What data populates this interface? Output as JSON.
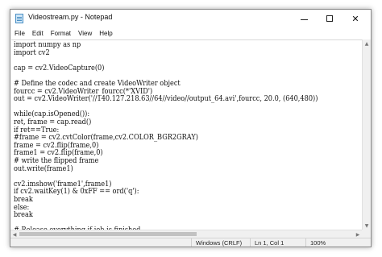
{
  "window": {
    "title": "Videostream.py - Notepad",
    "app_icon": "notepad-icon",
    "controls": {
      "minimize_icon": "minimize-icon",
      "maximize_icon": "maximize-icon",
      "close_glyph": "✕"
    }
  },
  "menu": {
    "items": [
      "File",
      "Edit",
      "Format",
      "View",
      "Help"
    ]
  },
  "editor": {
    "lines": [
      "import numpy as np",
      "import cv2",
      "",
      "cap = cv2.VideoCapture(0)",
      "",
      "# Define the codec and create VideoWriter object",
      "fourcc = cv2.VideoWriter_fourcc(*'XVID')",
      "out = cv2.VideoWriter('//140.127.218.63//64//video//output_64.avi',fourcc, 20.0, (640,480))",
      "",
      "while(cap.isOpened()):",
      "ret, frame = cap.read()",
      "if ret==True:",
      "#frame = cv2.cvtColor(frame,cv2.COLOR_BGR2GRAY)",
      "frame = cv2.flip(frame,0)",
      "frame1 = cv2.flip(frame,0)",
      "# write the flipped frame",
      "out.write(frame1)",
      "",
      "cv2.imshow('frame1',frame1)",
      "if cv2.waitKey(1) & 0xFF == ord('q'):",
      "break",
      "else:",
      "break",
      "",
      "# Release everything if job is finished"
    ]
  },
  "status": {
    "line_ending": "Windows (CRLF)",
    "position": "Ln 1, Col 1",
    "zoom": "100%"
  }
}
